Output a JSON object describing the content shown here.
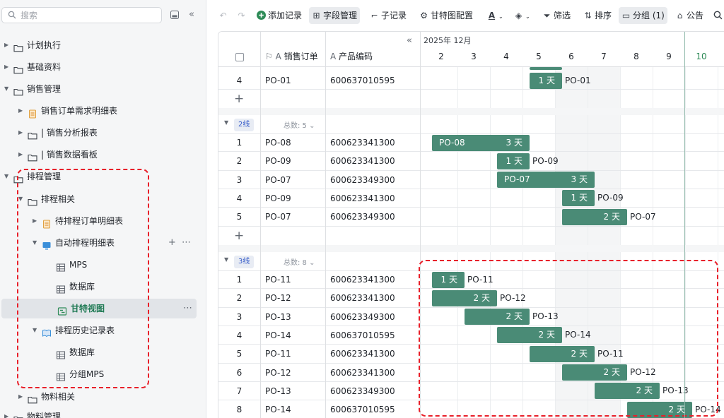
{
  "sidebar": {
    "search_placeholder": "搜索",
    "items": [
      {
        "label": "计划执行",
        "depth": 0,
        "icon": "folder-icon",
        "arrow": "▶"
      },
      {
        "label": "基础资料",
        "depth": 0,
        "icon": "folder-icon",
        "arrow": "▶"
      },
      {
        "label": "销售管理",
        "depth": 0,
        "icon": "folder-icon",
        "arrow": "▼"
      },
      {
        "label": "销售订单需求明细表",
        "depth": 1,
        "icon": "clipboard-icon",
        "arrow": "▶"
      },
      {
        "label": "| 销售分析报表",
        "depth": 1,
        "icon": "folder-chart-icon",
        "arrow": "▶"
      },
      {
        "label": "| 销售数据看板",
        "depth": 1,
        "icon": "folder-monitor-icon",
        "arrow": "▶"
      },
      {
        "label": "排程管理",
        "depth": 0,
        "icon": "folder-icon",
        "arrow": "▼"
      },
      {
        "label": "排程相关",
        "depth": 1,
        "icon": "folder-icon",
        "arrow": "▼"
      },
      {
        "label": "待排程订单明细表",
        "depth": 2,
        "icon": "clipboard-icon",
        "arrow": "▶"
      },
      {
        "label": "自动排程明细表",
        "depth": 2,
        "icon": "monitor-icon",
        "arrow": "▼"
      },
      {
        "label": "MPS",
        "depth": 3,
        "icon": "table-icon",
        "arrow": ""
      },
      {
        "label": "数据库",
        "depth": 3,
        "icon": "table-icon",
        "arrow": ""
      },
      {
        "label": "甘特视图",
        "depth": 3,
        "icon": "gantt-icon",
        "arrow": ""
      },
      {
        "label": "排程历史记录表",
        "depth": 2,
        "icon": "book-icon",
        "arrow": "▼"
      },
      {
        "label": "数据库",
        "depth": 3,
        "icon": "table-icon",
        "arrow": ""
      },
      {
        "label": "分组MPS",
        "depth": 3,
        "icon": "table-icon",
        "arrow": ""
      },
      {
        "label": "物料相关",
        "depth": 1,
        "icon": "folder-icon",
        "arrow": "▶"
      },
      {
        "label": "物料管理",
        "depth": 0,
        "icon": "folder-icon",
        "arrow": "▶"
      }
    ]
  },
  "toolbar": {
    "add_record": "添加记录",
    "field_manage": "字段管理",
    "sub_record": "子记录",
    "gantt_config": "甘特图配置",
    "filter": "筛选",
    "sort": "排序",
    "group": "分组 (1)",
    "announcement": "公告"
  },
  "grid": {
    "col_order": "销售订单",
    "col_code": "产品编码",
    "month_label": "2025年 12月",
    "days": [
      "2",
      "3",
      "4",
      "5",
      "6",
      "7",
      "8",
      "9",
      "10"
    ],
    "today": "10",
    "day_unit": "天",
    "groups": [
      {
        "tag": "",
        "count": "",
        "rows": [
          {
            "num": "4",
            "order": "PO-01",
            "code": "600637010595",
            "bar": {
              "start": 3,
              "len": 1,
              "days": "1",
              "name": "PO-01"
            }
          }
        ]
      },
      {
        "tag": "2线",
        "count": "总数: 5",
        "rows": [
          {
            "num": "1",
            "order": "PO-08",
            "code": "600623341300",
            "bar": {
              "start": 0,
              "len": 3,
              "days": "3",
              "name": "PO-08"
            }
          },
          {
            "num": "2",
            "order": "PO-09",
            "code": "600623341300",
            "bar": {
              "start": 2,
              "len": 1,
              "days": "1",
              "name": "PO-09"
            }
          },
          {
            "num": "3",
            "order": "PO-07",
            "code": "600623349300",
            "bar": {
              "start": 2,
              "len": 3,
              "days": "3",
              "name": "PO-07"
            }
          },
          {
            "num": "4",
            "order": "PO-09",
            "code": "600623341300",
            "bar": {
              "start": 4,
              "len": 1,
              "days": "1",
              "name": "PO-09"
            }
          },
          {
            "num": "5",
            "order": "PO-07",
            "code": "600623349300",
            "bar": {
              "start": 4,
              "len": 2,
              "days": "2",
              "name": "PO-07"
            }
          }
        ]
      },
      {
        "tag": "3线",
        "count": "总数: 8",
        "rows": [
          {
            "num": "1",
            "order": "PO-11",
            "code": "600623341300",
            "bar": {
              "start": 0,
              "len": 1,
              "days": "1",
              "name": "PO-11"
            }
          },
          {
            "num": "2",
            "order": "PO-12",
            "code": "600623341300",
            "bar": {
              "start": 0,
              "len": 2,
              "days": "2",
              "name": "PO-12"
            }
          },
          {
            "num": "3",
            "order": "PO-13",
            "code": "600623349300",
            "bar": {
              "start": 1,
              "len": 2,
              "days": "2",
              "name": "PO-13"
            }
          },
          {
            "num": "4",
            "order": "PO-14",
            "code": "600637010595",
            "bar": {
              "start": 2,
              "len": 2,
              "days": "2",
              "name": "PO-14"
            }
          },
          {
            "num": "5",
            "order": "PO-11",
            "code": "600623341300",
            "bar": {
              "start": 3,
              "len": 2,
              "days": "2",
              "name": "PO-11"
            }
          },
          {
            "num": "6",
            "order": "PO-12",
            "code": "600623341300",
            "bar": {
              "start": 4,
              "len": 2,
              "days": "2",
              "name": "PO-12"
            }
          },
          {
            "num": "7",
            "order": "PO-13",
            "code": "600623349300",
            "bar": {
              "start": 5,
              "len": 2,
              "days": "2",
              "name": "PO-13"
            }
          },
          {
            "num": "8",
            "order": "PO-14",
            "code": "600637010595",
            "bar": {
              "start": 6,
              "len": 2,
              "days": "2",
              "name": "PO-14"
            }
          }
        ]
      }
    ]
  },
  "colors": {
    "bar": "#4a8b76",
    "annotation": "#e8202a",
    "tag_text": "#2f56c7"
  }
}
